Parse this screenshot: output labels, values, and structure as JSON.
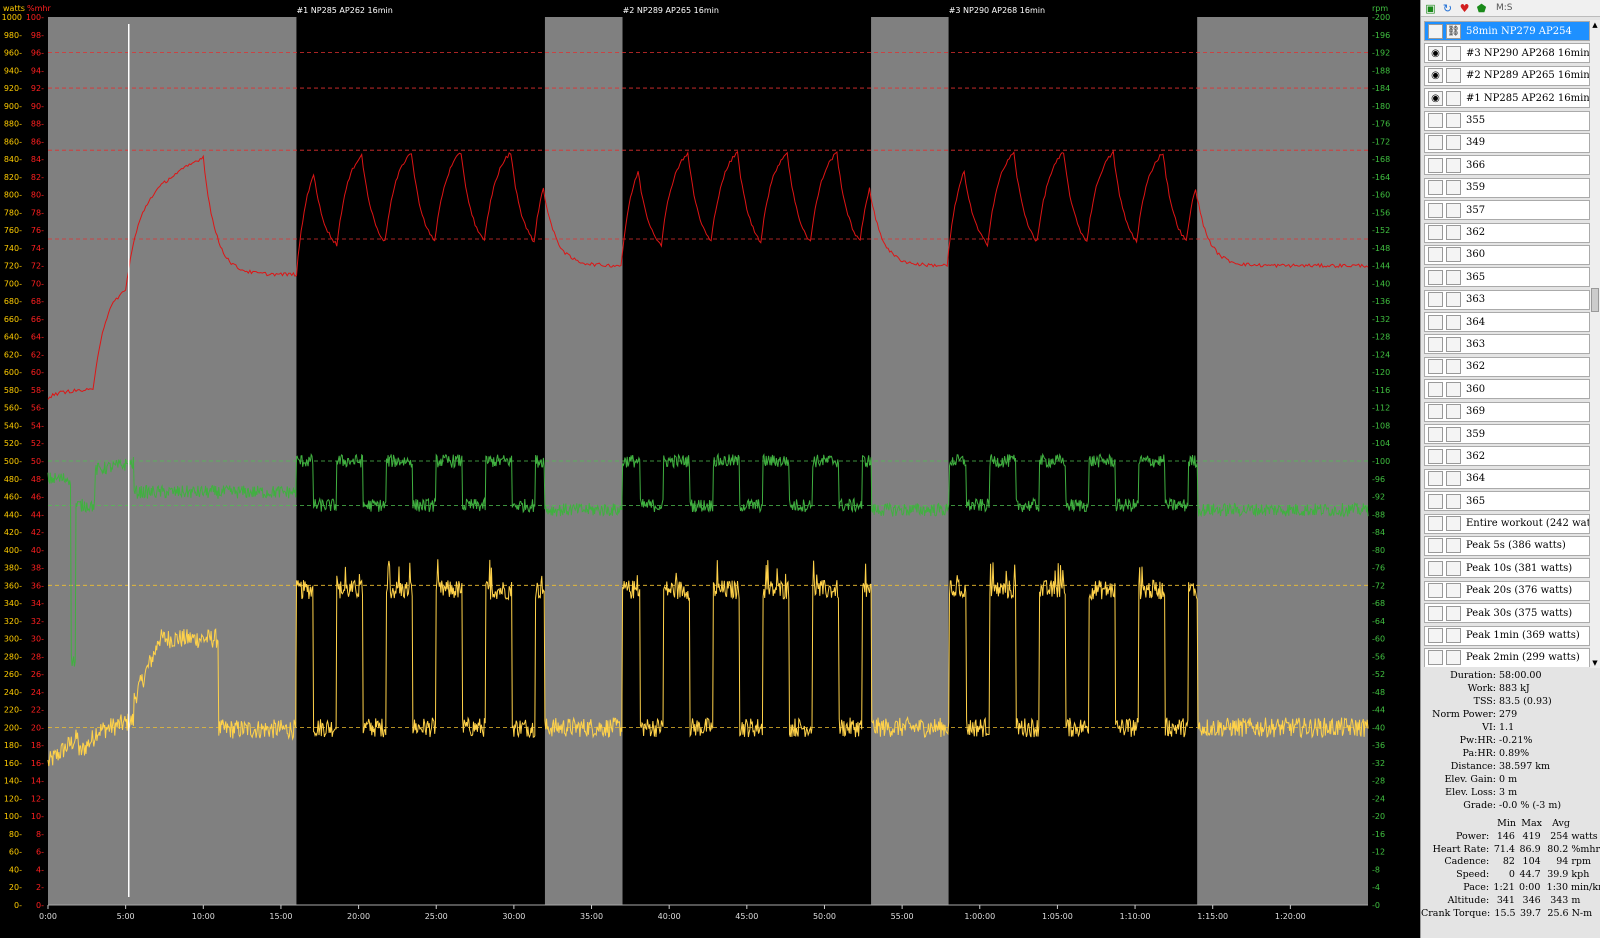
{
  "chart": {
    "axis_labels": {
      "left_watts": "watts",
      "left_hr": "%mhr",
      "right_rpm": "rpm"
    },
    "interval_titles": [
      {
        "label": "#1 NP285 AP262 16min",
        "at_min": 16
      },
      {
        "label": "#2 NP289 AP265 16min",
        "at_min": 37
      },
      {
        "label": "#3 NP290 AP268 16min",
        "at_min": 58
      }
    ],
    "x_ticks": [
      "0:00",
      "5:00",
      "10:00",
      "15:00",
      "20:00",
      "25:00",
      "30:00",
      "35:00",
      "40:00",
      "45:00",
      "50:00",
      "55:00",
      "1:00:00",
      "1:05:00",
      "1:10:00",
      "1:15:00",
      "1:20:00"
    ],
    "x_range_min": [
      0,
      85
    ],
    "watts_range": [
      0,
      1000
    ],
    "hr_range": [
      0,
      100
    ],
    "rpm_range": [
      0,
      200
    ],
    "colors": {
      "watts_axis": "#ffcc00",
      "hr_axis": "#ff2020",
      "rpm_axis": "#40c040",
      "power": "#ffd24a",
      "heart_rate": "#dd1515",
      "cadence": "#40b040",
      "rest_band": "#808080",
      "interval_band": "#000000",
      "marker": "#ffffff"
    },
    "shading": [
      {
        "type": "rest",
        "from": 0,
        "to": 16
      },
      {
        "type": "interval",
        "from": 16,
        "to": 32
      },
      {
        "type": "rest",
        "from": 32,
        "to": 37
      },
      {
        "type": "interval",
        "from": 37,
        "to": 53
      },
      {
        "type": "rest",
        "from": 53,
        "to": 58
      },
      {
        "type": "interval",
        "from": 58,
        "to": 74
      },
      {
        "type": "rest",
        "from": 74,
        "to": 85
      }
    ],
    "cursor_marker_min": 5.2,
    "ref_lines": {
      "hr": [
        96,
        92,
        85,
        75
      ],
      "cadence": [
        100,
        90
      ],
      "power": [
        360,
        200
      ]
    }
  },
  "sidebar": {
    "toolbar": {
      "icons": [
        "chart-icon",
        "refresh-icon",
        "heart-icon",
        "shield-icon"
      ],
      "label": "M:S"
    },
    "intervals": [
      {
        "label": "58min NP279 AP254",
        "selected": true,
        "check": "",
        "icon": "link"
      },
      {
        "label": "#3 NP290 AP268 16min",
        "selected": false,
        "check": "eye"
      },
      {
        "label": "#2 NP289 AP265 16min",
        "selected": false,
        "check": "eye"
      },
      {
        "label": "#1 NP285 AP262 16min",
        "selected": false,
        "check": "eye"
      },
      {
        "label": "355"
      },
      {
        "label": "349"
      },
      {
        "label": "366"
      },
      {
        "label": "359"
      },
      {
        "label": "357"
      },
      {
        "label": "362"
      },
      {
        "label": "360"
      },
      {
        "label": "365"
      },
      {
        "label": "363"
      },
      {
        "label": "364"
      },
      {
        "label": "363"
      },
      {
        "label": "362"
      },
      {
        "label": "360"
      },
      {
        "label": "369"
      },
      {
        "label": "359"
      },
      {
        "label": "362"
      },
      {
        "label": "364"
      },
      {
        "label": "365"
      },
      {
        "label": "Entire workout (242 watts)"
      },
      {
        "label": "Peak 5s (386 watts)"
      },
      {
        "label": "Peak 10s (381 watts)"
      },
      {
        "label": "Peak 20s (376 watts)"
      },
      {
        "label": "Peak 30s (375 watts)"
      },
      {
        "label": "Peak 1min (369 watts)"
      },
      {
        "label": "Peak 2min (299 watts)"
      }
    ],
    "summary": [
      {
        "label": "Duration:",
        "value": "58:00.00"
      },
      {
        "label": "Work:",
        "value": "883 kJ"
      },
      {
        "label": "TSS:",
        "value": "83.5 (0.93)"
      },
      {
        "label": "Norm Power:",
        "value": "279"
      },
      {
        "label": "VI:",
        "value": "1.1"
      },
      {
        "label": "Pw:HR:",
        "value": "-0.21%"
      },
      {
        "label": "Pa:HR:",
        "value": "0.89%"
      },
      {
        "label": "Distance:",
        "value": "38.597 km"
      },
      {
        "label": "Elev. Gain:",
        "value": "0 m"
      },
      {
        "label": "Elev. Loss:",
        "value": "3 m"
      },
      {
        "label": "Grade:",
        "value": "-0.0 % (-3 m)"
      }
    ],
    "stats_header": {
      "min": "Min",
      "max": "Max",
      "avg": "Avg"
    },
    "stats": [
      {
        "label": "Power:",
        "min": "146",
        "max": "419",
        "avg": "254",
        "unit": "watts"
      },
      {
        "label": "Heart Rate:",
        "min": "71.4",
        "max": "86.9",
        "avg": "80.2",
        "unit": "%mhr"
      },
      {
        "label": "Cadence:",
        "min": "82",
        "max": "104",
        "avg": "94",
        "unit": "rpm"
      },
      {
        "label": "Speed:",
        "min": "0",
        "max": "44.7",
        "avg": "39.9",
        "unit": "kph"
      },
      {
        "label": "Pace:",
        "min": "1:21",
        "max": "0:00",
        "avg": "1:30",
        "unit": "min/km"
      },
      {
        "label": "Altitude:",
        "min": "341",
        "max": "346",
        "avg": "343",
        "unit": "m"
      },
      {
        "label": "Crank Torque:",
        "min": "15.5",
        "max": "39.7",
        "avg": "25.6",
        "unit": "N-m"
      }
    ]
  }
}
